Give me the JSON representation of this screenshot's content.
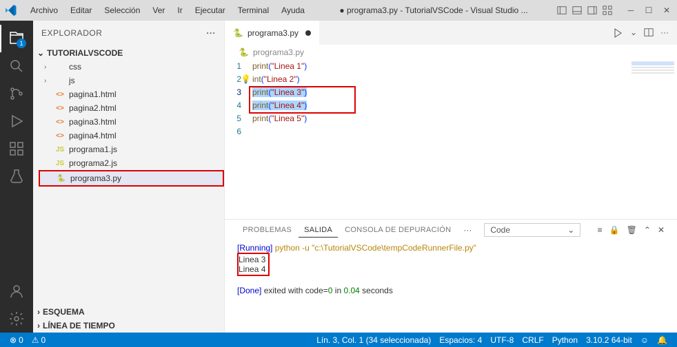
{
  "titlebar": {
    "menus": [
      "Archivo",
      "Editar",
      "Selección",
      "Ver",
      "Ir",
      "Ejecutar",
      "Terminal",
      "Ayuda"
    ],
    "title_prefix": "●",
    "title": "programa3.py - TutorialVSCode - Visual Studio ..."
  },
  "activitybar": {
    "files_badge": "1"
  },
  "sidebar": {
    "header": "EXPLORADOR",
    "project": "TUTORIALVSCODE",
    "folders": [
      {
        "name": "css"
      },
      {
        "name": "js"
      }
    ],
    "files": [
      {
        "name": "pagina1.html",
        "type": "html"
      },
      {
        "name": "pagina2.html",
        "type": "html"
      },
      {
        "name": "pagina3.html",
        "type": "html"
      },
      {
        "name": "pagina4.html",
        "type": "html"
      },
      {
        "name": "programa1.js",
        "type": "js"
      },
      {
        "name": "programa2.js",
        "type": "js"
      },
      {
        "name": "programa3.py",
        "type": "py",
        "selected": true
      }
    ],
    "sections": {
      "esquema": "ESQUEMA",
      "timeline": "LÍNEA DE TIEMPO"
    }
  },
  "editor": {
    "tab_label": "programa3.py",
    "breadcrumb": "programa3.py",
    "code": [
      {
        "n": 1,
        "fn": "print",
        "str": "\"Linea 1\""
      },
      {
        "n": 2,
        "fn": "int",
        "str": "\"Linea 2\"",
        "bulb": true
      },
      {
        "n": 3,
        "fn": "print",
        "str": "\"Linea 3\"",
        "sel": true
      },
      {
        "n": 4,
        "fn": "print",
        "str": "\"Linea 4\"",
        "sel": true
      },
      {
        "n": 5,
        "fn": "print",
        "str": "\"Linea 5\""
      },
      {
        "n": 6
      }
    ]
  },
  "panel": {
    "tabs": {
      "problemas": "PROBLEMAS",
      "salida": "SALIDA",
      "consola": "CONSOLA DE DEPURACIÓN"
    },
    "dropdown": "Code",
    "output": {
      "running_label": "[Running]",
      "running_cmd": " python -u \"c:\\TutorialVSCode\\tempCodeRunnerFile.py\"",
      "lines": [
        "Linea 3",
        "Linea 4"
      ],
      "done_label": "[Done]",
      "done_text": " exited with code=",
      "done_code": "0",
      "done_in": " in ",
      "done_time": "0.04",
      "done_suffix": " seconds"
    }
  },
  "statusbar": {
    "errors": "0",
    "warnings": "0",
    "line_col": "Lín. 3, Col. 1 (34 seleccionada)",
    "spaces": "Espacios: 4",
    "encoding": "UTF-8",
    "eol": "CRLF",
    "lang": "Python",
    "version": "3.10.2 64-bit"
  }
}
